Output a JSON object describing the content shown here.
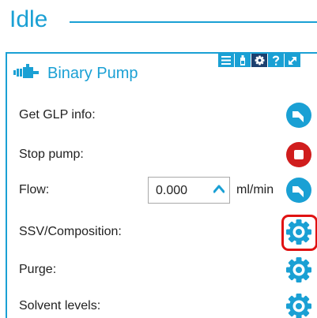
{
  "status": {
    "title": "Idle"
  },
  "panel": {
    "title": "Binary Pump",
    "toolbar": {
      "buttons": [
        {
          "icon": "list-icon",
          "active": false
        },
        {
          "icon": "bottle-icon",
          "active": false
        },
        {
          "icon": "gear-icon",
          "active": true
        },
        {
          "icon": "help-icon",
          "active": false
        },
        {
          "icon": "expand-icon",
          "active": false
        }
      ]
    },
    "rows": {
      "glp": {
        "label": "Get GLP info:",
        "action_icon": "glp-info-icon"
      },
      "stop": {
        "label": "Stop pump:",
        "action_icon": "stop-icon"
      },
      "flow": {
        "label": "Flow:",
        "value": "0.000",
        "unit": "ml/min",
        "action_icon": "apply-icon"
      },
      "ssv": {
        "label": "SSV/Composition:",
        "action_icon": "gear-icon",
        "highlighted": true
      },
      "purge": {
        "label": "Purge:",
        "action_icon": "gear-icon"
      },
      "solvent": {
        "label": "Solvent levels:",
        "action_icon": "gear-icon"
      }
    }
  },
  "colors": {
    "accent": "#1aa0d4",
    "toolbar_active": "#1b3f6e",
    "stop": "#d01d1d",
    "highlight": "#e01212"
  }
}
